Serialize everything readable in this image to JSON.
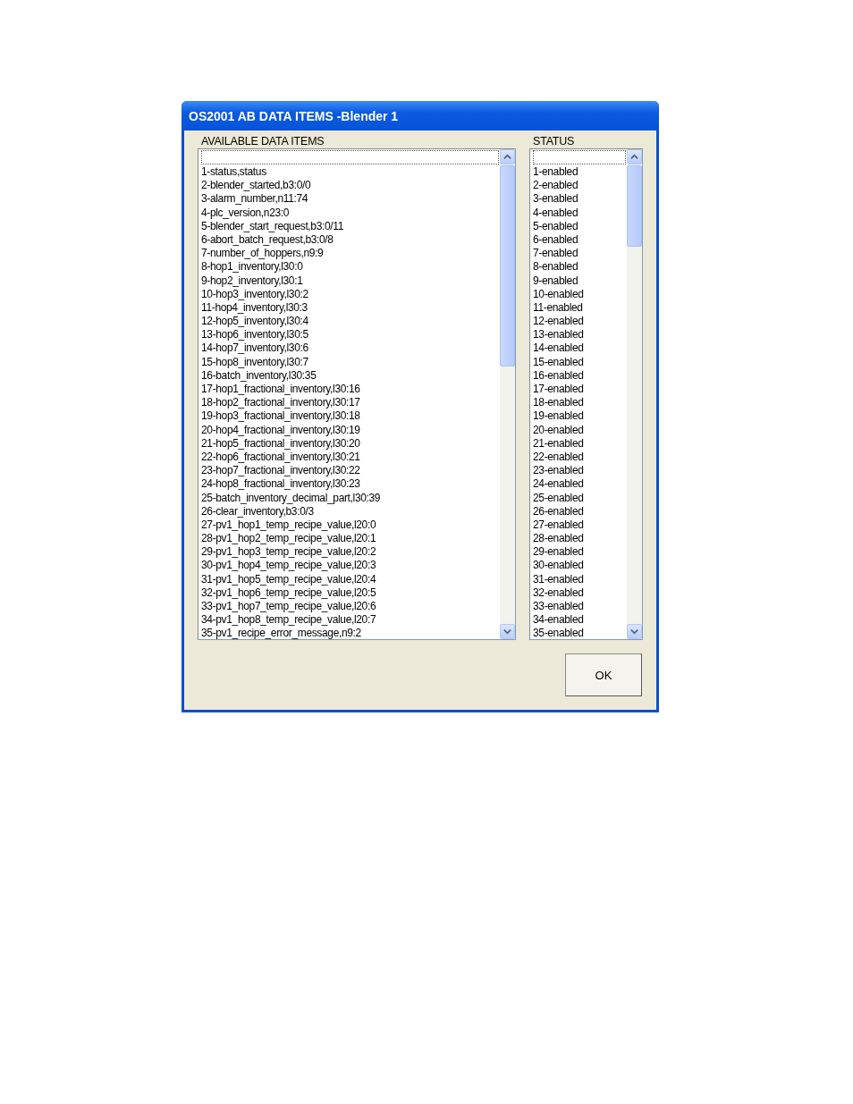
{
  "window": {
    "title": "OS2001 AB DATA ITEMS -Blender 1"
  },
  "available": {
    "label": "AVAILABLE DATA ITEMS",
    "items": [
      "1-status,status",
      "2-blender_started,b3:0/0",
      "3-alarm_number,n11:74",
      "4-plc_version,n23:0",
      "5-blender_start_request,b3:0/11",
      "6-abort_batch_request,b3:0/8",
      "7-number_of_hoppers,n9:9",
      "8-hop1_inventory,l30:0",
      "9-hop2_inventory,l30:1",
      "10-hop3_inventory,l30:2",
      "11-hop4_inventory,l30:3",
      "12-hop5_inventory,l30:4",
      "13-hop6_inventory,l30:5",
      "14-hop7_inventory,l30:6",
      "15-hop8_inventory,l30:7",
      "16-batch_inventory,l30:35",
      "17-hop1_fractional_inventory,l30:16",
      "18-hop2_fractional_inventory,l30:17",
      "19-hop3_fractional_inventory,l30:18",
      "20-hop4_fractional_inventory,l30:19",
      "21-hop5_fractional_inventory,l30:20",
      "22-hop6_fractional_inventory,l30:21",
      "23-hop7_fractional_inventory,l30:22",
      "24-hop8_fractional_inventory,l30:23",
      "25-batch_inventory_decimal_part,l30:39",
      "26-clear_inventory,b3:0/3",
      "27-pv1_hop1_temp_recipe_value,l20:0",
      "28-pv1_hop2_temp_recipe_value,l20:1",
      "29-pv1_hop3_temp_recipe_value,l20:2",
      "30-pv1_hop4_temp_recipe_value,l20:3",
      "31-pv1_hop5_temp_recipe_value,l20:4",
      "32-pv1_hop6_temp_recipe_value,l20:5",
      "33-pv1_hop7_temp_recipe_value,l20:6",
      "34-pv1_hop8_temp_recipe_value,l20:7",
      "35-pv1_recipe_error_message,n9:2"
    ]
  },
  "status": {
    "label": "STATUS",
    "items": [
      "1-enabled",
      "2-enabled",
      "3-enabled",
      "4-enabled",
      "5-enabled",
      "6-enabled",
      "7-enabled",
      "8-enabled",
      "9-enabled",
      "10-enabled",
      "11-enabled",
      "12-enabled",
      "13-enabled",
      "14-enabled",
      "15-enabled",
      "16-enabled",
      "17-enabled",
      "18-enabled",
      "19-enabled",
      "20-enabled",
      "21-enabled",
      "22-enabled",
      "23-enabled",
      "24-enabled",
      "25-enabled",
      "26-enabled",
      "27-enabled",
      "28-enabled",
      "29-enabled",
      "30-enabled",
      "31-enabled",
      "32-enabled",
      "33-enabled",
      "34-enabled",
      "35-enabled"
    ]
  },
  "buttons": [
    "OK"
  ]
}
